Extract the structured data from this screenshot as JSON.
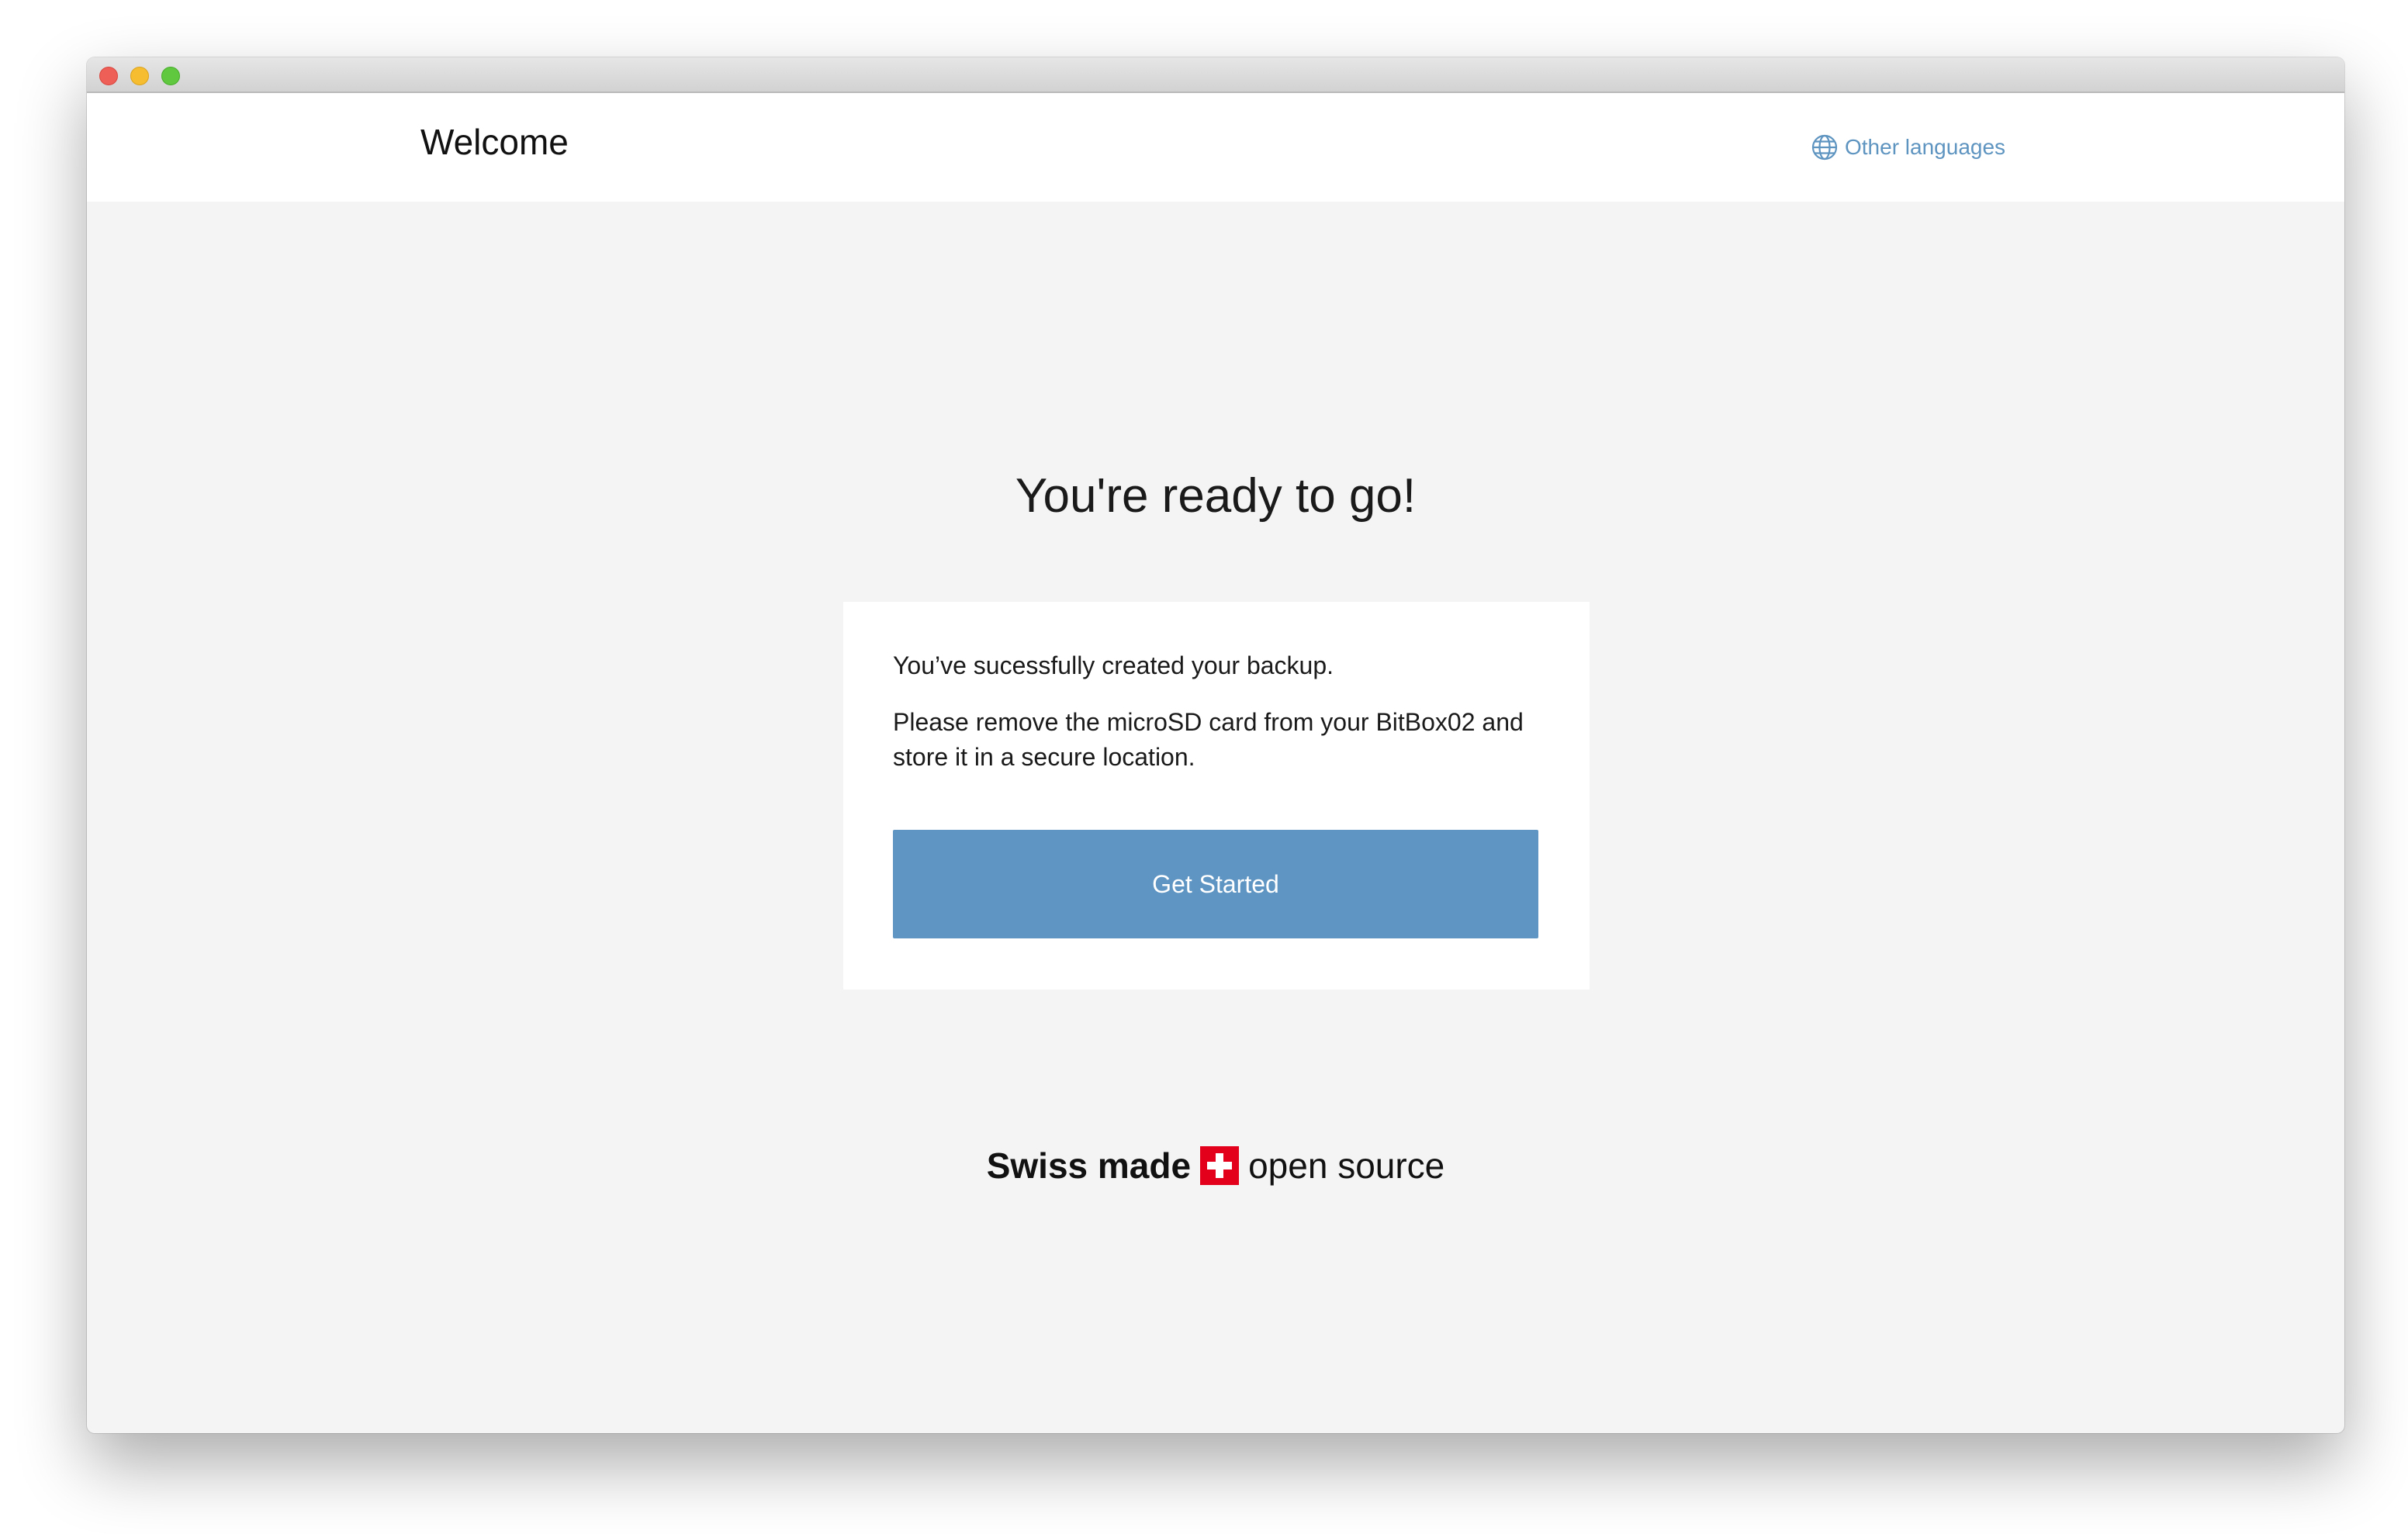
{
  "header": {
    "title": "Welcome",
    "language_link": "Other languages"
  },
  "main": {
    "headline": "You're ready to go!",
    "card": {
      "message_1": "You’ve sucessfully created your backup.",
      "message_2": "Please remove the microSD card from your BitBox02 and store it in a secure location.",
      "button_label": "Get Started"
    },
    "footer": {
      "bold_text": "Swiss made",
      "regular_text": "open source"
    }
  },
  "icons": {
    "language": "globe-icon",
    "brand": "swiss-flag-icon"
  },
  "colors": {
    "accent": "#5f95c2",
    "link": "#5e94c0",
    "flag_red": "#e2001a",
    "background": "#f4f4f4",
    "card": "#ffffff"
  }
}
